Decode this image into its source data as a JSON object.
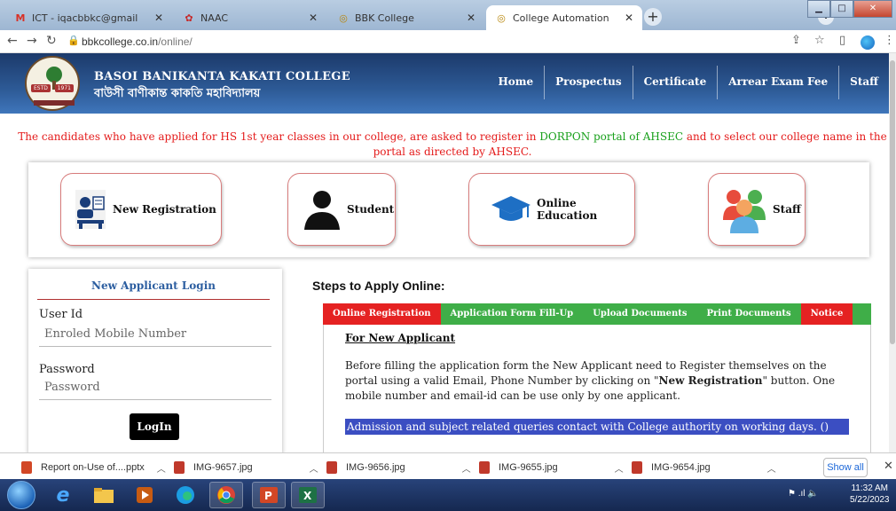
{
  "browser": {
    "tabs": [
      {
        "label": "ICT - iqacbbkc@gmail.com - Gm"
      },
      {
        "label": "NAAC"
      },
      {
        "label": "BBK College"
      },
      {
        "label": "College Automation"
      }
    ],
    "url_domain": "bbkcollege.co.in",
    "url_path": "/online/"
  },
  "site": {
    "college_name_en": "BASOI BANIKANTA KAKATI COLLEGE",
    "college_name_bn": "বাউসী বাণীকান্ত কাকতি মহাবিদ্যালয়",
    "logo_est": "ESTD",
    "logo_year": "1971",
    "nav": [
      "Home",
      "Prospectus",
      "Certificate",
      "Arrear Exam Fee",
      "Staff"
    ]
  },
  "notice": {
    "part1": "The candidates who have applied for HS 1st year classes in our college, are asked to register in ",
    "highlight": "DORPON portal of AHSEC",
    "part2": " and to select our college name in the portal as directed by AHSEC."
  },
  "tiles": [
    "New Registration",
    "Student",
    "Online Education",
    "Staff"
  ],
  "login": {
    "title": "New Applicant Login",
    "user_label": "User Id",
    "user_placeholder": "Enroled Mobile Number",
    "pass_label": "Password",
    "pass_placeholder": "Password",
    "button": "LogIn"
  },
  "steps": {
    "title": "Steps to Apply Online:",
    "tabs": [
      "Online Registration",
      "Application Form Fill-Up",
      "Upload Documents",
      "Print Documents",
      "Notice"
    ],
    "heading": "For New Applicant",
    "text_a": "Before filling the application form the New Applicant need to Register themselves on the portal using a valid Email, Phone Number by clicking on \"",
    "text_bold": "New Registration",
    "text_b": "\" button. One mobile number and email-id can be use only by one applicant.",
    "highlight": "Admission and subject related queries contact with College authority on working days. ()"
  },
  "downloads": {
    "items": [
      "Report on-Use of....pptx",
      "IMG-9657.jpg",
      "IMG-9656.jpg",
      "IMG-9655.jpg",
      "IMG-9654.jpg"
    ],
    "show_all": "Show all"
  },
  "taskbar": {
    "time": "11:32 AM",
    "date": "5/22/2023"
  },
  "colors": {
    "header_blue": "#2d5a96",
    "notice_red": "#e41b1b",
    "notice_green": "#18a01b",
    "tab_red": "#e52222",
    "tab_green": "#3fae48",
    "highlight_blue": "#3b4ec2"
  }
}
